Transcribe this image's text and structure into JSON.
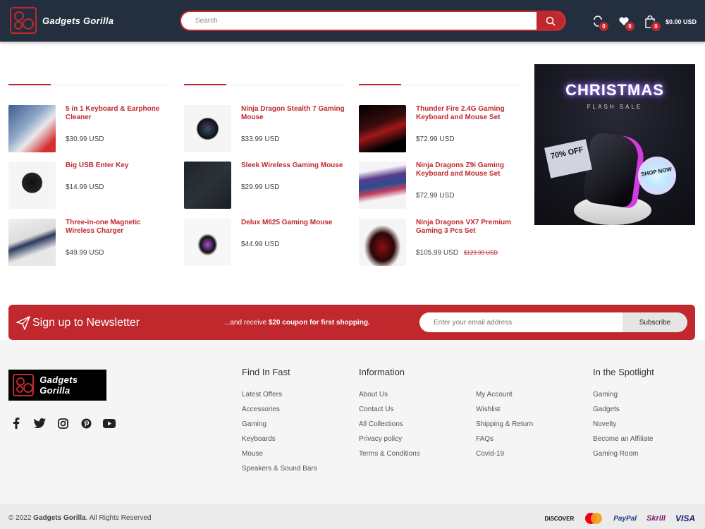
{
  "header": {
    "brand": "Gadgets Gorilla",
    "search_placeholder": "Search",
    "compare_count": "0",
    "wishlist_count": "0",
    "cart_count": "0",
    "cart_total": "$0.00 USD"
  },
  "columns": [
    {
      "products": [
        {
          "name": "5 in 1 Keyboard & Earphone Cleaner",
          "price": "$30.99 USD"
        },
        {
          "name": "Big USB Enter Key",
          "price": "$14.99 USD"
        },
        {
          "name": "Three-in-one Magnetic Wireless Charger",
          "price": "$49.99 USD"
        }
      ]
    },
    {
      "products": [
        {
          "name": "Ninja Dragon Stealth 7 Gaming Mouse",
          "price": "$33.99 USD"
        },
        {
          "name": "Sleek Wireless Gaming Mouse",
          "price": "$29.99 USD"
        },
        {
          "name": "Delux M625 Gaming Mouse",
          "price": "$44.99 USD"
        }
      ]
    },
    {
      "products": [
        {
          "name": "Thunder Fire 2.4G Gaming Keyboard and Mouse Set",
          "price": "$72.99 USD"
        },
        {
          "name": "Ninja Dragons Z9i Gaming Keyboard and Mouse Set",
          "price": "$72.99 USD"
        },
        {
          "name": "Ninja Dragons VX7 Premium Gaming 3 Pcs Set",
          "price": "$105.99 USD",
          "old_price": "$129.99 USD"
        }
      ]
    }
  ],
  "banner": {
    "title": "CHRISTMAS",
    "subtitle": "FLASH SALE",
    "discount": "70% OFF",
    "cta": "SHOP NOW"
  },
  "newsletter": {
    "title": "Sign up to Newsletter",
    "msg_prefix": "...and receive ",
    "msg_bold": "$20 coupon for first shopping.",
    "input_placeholder": "Enter your email address",
    "button": "Subscribe"
  },
  "footer": {
    "find_title": "Find In Fast",
    "find_links": [
      "Latest Offers",
      "Accessories",
      "Gaming",
      "Keyboards",
      "Mouse",
      "Speakers & Sound Bars"
    ],
    "info_title": "Information",
    "info_links": [
      "About Us",
      "Contact Us",
      "All Collections",
      "Privacy policy",
      "Terms & Conditions"
    ],
    "info_links2": [
      "My Account",
      "Wishlist",
      "Shipping & Return",
      "FAQs",
      "Covid-19"
    ],
    "spot_title": "In the Spotlight",
    "spot_links": [
      "Gaming",
      "Gadgets",
      "Novelty",
      "Become an Affiliate",
      "Gaming Room"
    ],
    "social": [
      "facebook-icon",
      "twitter-icon",
      "instagram-icon",
      "pinterest-icon",
      "youtube-icon"
    ]
  },
  "bottom": {
    "copy_prefix": "© 2022 ",
    "copy_brand": "Gadgets Gorilla",
    "copy_suffix": ". All Rights Reserved",
    "payments": [
      "DISCOVER",
      "mastercard",
      "PayPal",
      "Skrill",
      "VISA"
    ]
  },
  "colors": {
    "accent": "#c0282d",
    "header_bg": "#232f3e"
  }
}
